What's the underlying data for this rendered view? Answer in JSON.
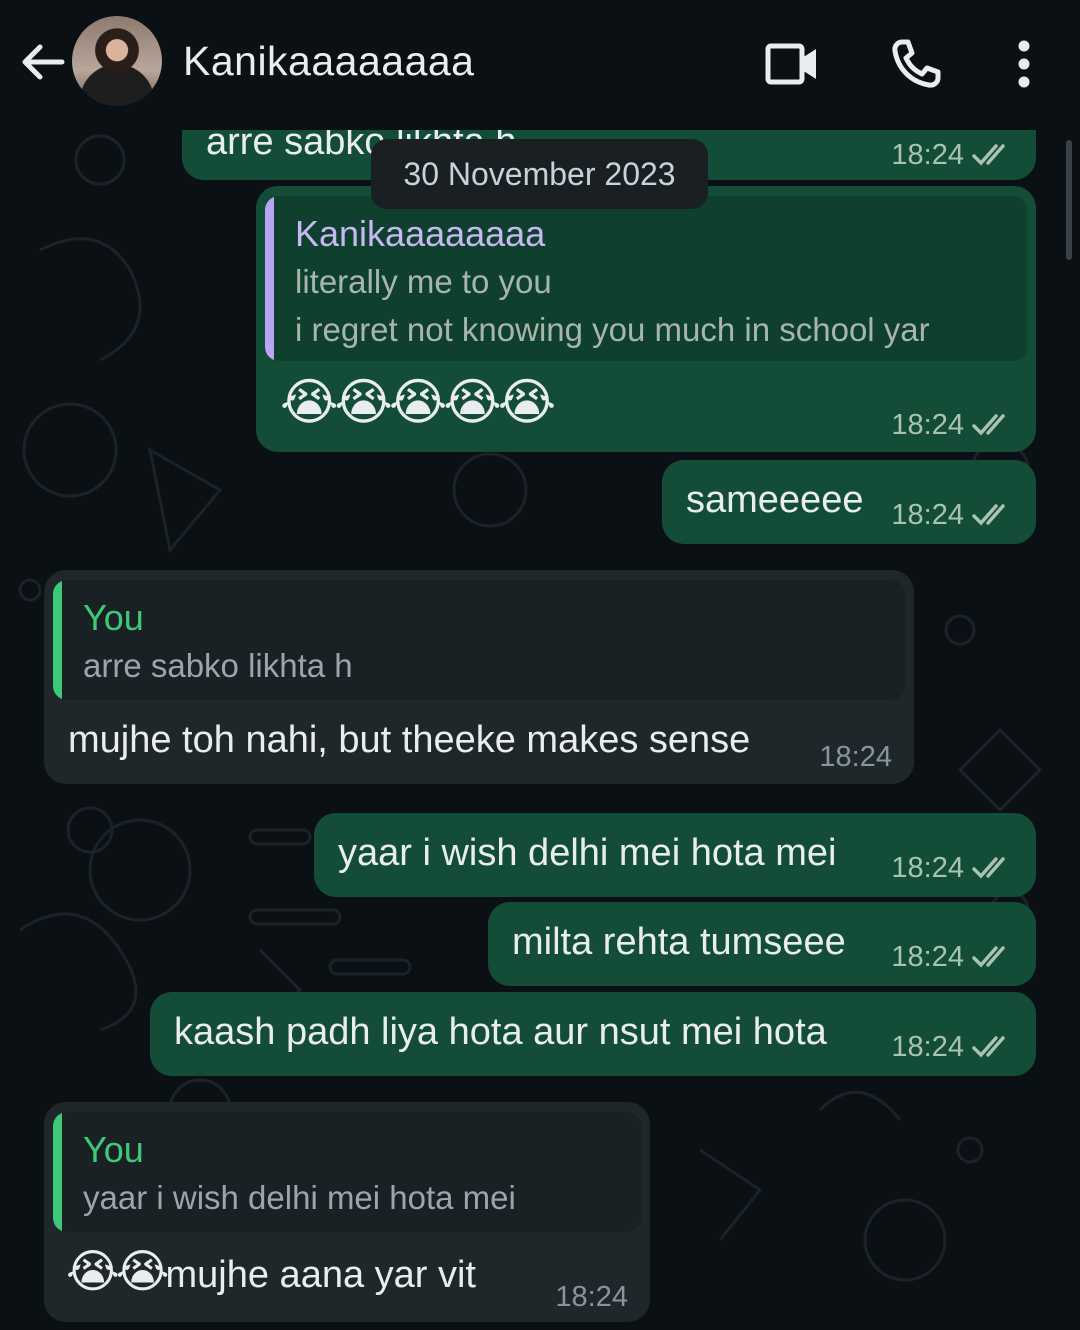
{
  "header": {
    "contact_name": "Kanikaaaaaaaa",
    "back_icon": "arrow-left-icon",
    "avatar": "contact-avatar",
    "video_icon": "video-call-icon",
    "call_icon": "phone-icon",
    "menu_icon": "more-vertical-icon"
  },
  "colors": {
    "background": "#0b1014",
    "outgoing_bubble": "#134d37",
    "incoming_bubble": "#1f272a",
    "quote_author_contact": "#b9a6f0",
    "quote_author_you": "#3ec979"
  },
  "chat": {
    "date_chip": "30 November 2023",
    "partial_top": {
      "text": "arre sabko likhta h",
      "time": "18:24"
    },
    "messages": [
      {
        "direction": "outgoing",
        "quote_author": "Kanikaaaaaaaa",
        "quote_line1": "literally me to you",
        "quote_line2": "i regret not knowing you much in school yar",
        "text": "😭😭😭😭😭",
        "time": "18:24"
      },
      {
        "direction": "outgoing",
        "text": "sameeeee",
        "time": "18:24"
      },
      {
        "direction": "incoming",
        "quote_author": "You",
        "quote_text": "arre sabko likhta h",
        "text": "mujhe toh nahi, but theeke makes sense",
        "time": "18:24"
      },
      {
        "direction": "outgoing",
        "text": "yaar i wish delhi mei hota mei",
        "time": "18:24"
      },
      {
        "direction": "outgoing",
        "text": "milta rehta tumseee",
        "time": "18:24"
      },
      {
        "direction": "outgoing",
        "text": "kaash padh liya hota aur nsut mei hota",
        "time": "18:24"
      },
      {
        "direction": "incoming",
        "quote_author": "You",
        "quote_text": "yaar i wish delhi mei hota mei",
        "emoji_prefix": "😭😭",
        "text": "mujhe aana yar vit",
        "time": "18:24"
      }
    ]
  }
}
